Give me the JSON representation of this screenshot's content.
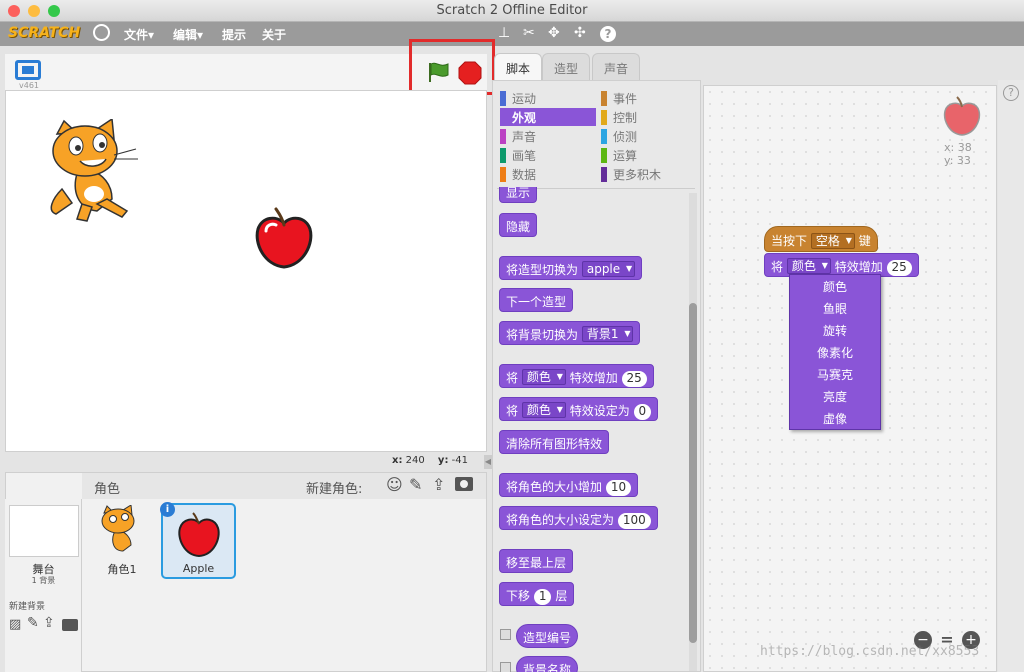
{
  "window": {
    "title": "Scratch 2 Offline Editor"
  },
  "menubar": {
    "logo": "SCRATCH",
    "items": [
      "文件▾",
      "编辑▾",
      "提示",
      "关于"
    ],
    "tools": [
      "stamp-icon",
      "cut-icon",
      "grow-icon",
      "shrink-icon",
      "help-icon"
    ]
  },
  "stage": {
    "version": "v461",
    "coords": {
      "x_label": "x:",
      "x": "240",
      "y_label": "y:",
      "y": "-41"
    }
  },
  "sprites": {
    "header": "角色",
    "new_sprite_label": "新建角色:",
    "stage_label": "舞台",
    "stage_sub": "1 背景",
    "new_backdrop_label": "新建背景",
    "items": [
      {
        "name": "角色1",
        "selected": false
      },
      {
        "name": "Apple",
        "selected": true
      }
    ]
  },
  "tabs": [
    "脚本",
    "造型",
    "声音"
  ],
  "categories": {
    "left": [
      {
        "label": "运动",
        "color": "#4a6cd4"
      },
      {
        "label": "外观",
        "color": "#8a55d7",
        "selected": true
      },
      {
        "label": "声音",
        "color": "#bb42c3"
      },
      {
        "label": "画笔",
        "color": "#0e9a6c"
      },
      {
        "label": "数据",
        "color": "#ee7d16"
      }
    ],
    "right": [
      {
        "label": "事件",
        "color": "#c88330"
      },
      {
        "label": "控制",
        "color": "#e1a91a"
      },
      {
        "label": "侦测",
        "color": "#2ca5e2"
      },
      {
        "label": "运算",
        "color": "#5cb712"
      },
      {
        "label": "更多积木",
        "color": "#632d99"
      }
    ]
  },
  "palette_blocks": {
    "show": "显示",
    "hide": "隐藏",
    "switch_costume": {
      "text": "将造型切换为",
      "value": "apple"
    },
    "next_costume": "下一个造型",
    "switch_backdrop": {
      "text": "将背景切换为",
      "value": "背景1"
    },
    "change_effect": {
      "prefix": "将",
      "effect": "颜色",
      "text": "特效增加",
      "value": "25"
    },
    "set_effect": {
      "prefix": "将",
      "effect": "颜色",
      "text": "特效设定为",
      "value": "0"
    },
    "clear_effects": "清除所有图形特效",
    "change_size": {
      "text": "将角色的大小增加",
      "value": "10"
    },
    "set_size": {
      "text": "将角色的大小设定为",
      "value": "100"
    },
    "go_front": "移至最上层",
    "go_back": {
      "text": "下移",
      "value": "1",
      "suffix": "层"
    },
    "costume_num": "造型编号",
    "backdrop_name": "背景名称"
  },
  "script": {
    "hat": {
      "text": "当按下",
      "key": "空格",
      "suffix": "键"
    },
    "block": {
      "prefix": "将",
      "effect": "颜色",
      "text": "特效增加",
      "value": "25"
    },
    "dropdown_options": [
      "颜色",
      "鱼眼",
      "旋转",
      "像素化",
      "马赛克",
      "亮度",
      "虚像"
    ],
    "sprite_coords": {
      "x": "x: 38",
      "y": "y: 33"
    }
  },
  "watermark": "https://blog.csdn.net/xx8553"
}
